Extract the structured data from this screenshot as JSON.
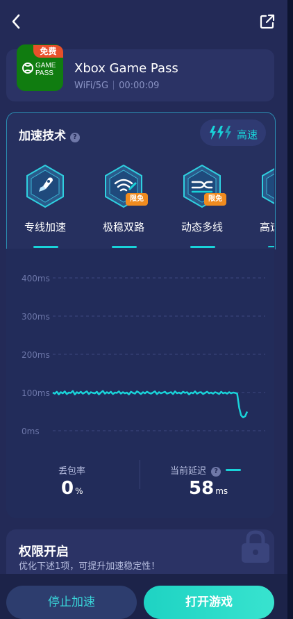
{
  "colors": {
    "background": "#232a57",
    "accent": "#19d3d9",
    "badge": "#f08b1f",
    "free_tag": "#e8502a",
    "xbox_green": "#107c10"
  },
  "header": {
    "back_icon": "chevron-left-icon",
    "share_icon": "external-link-icon"
  },
  "game": {
    "free_tag": "免费",
    "logo_line1": "GAME",
    "logo_line2": "PASS",
    "title": "Xbox Game Pass",
    "network": "WiFi/5G",
    "duration": "00:00:09"
  },
  "accel": {
    "title": "加速技术",
    "speed_label": "高速",
    "items": [
      {
        "label": "专线加速",
        "icon": "rocket-icon",
        "badge": ""
      },
      {
        "label": "极稳双路",
        "icon": "wifi-signal-icon",
        "badge": "限免"
      },
      {
        "label": "动态多线",
        "icon": "multi-line-icon",
        "badge": "限免"
      },
      {
        "label": "高速",
        "icon": "speed-icon",
        "badge": ""
      }
    ]
  },
  "chart_data": {
    "type": "line",
    "title": "",
    "xlabel": "",
    "ylabel": "",
    "ylim": [
      0,
      400
    ],
    "yticks": [
      "400ms",
      "300ms",
      "200ms",
      "100ms",
      "0ms"
    ],
    "grid": true,
    "series": [
      {
        "values": [
          100,
          97,
          102,
          95,
          101,
          98,
          103,
          96,
          100,
          99,
          104,
          95,
          101,
          98,
          102,
          97,
          100,
          103,
          96,
          101,
          99,
          98,
          102,
          95,
          100,
          104,
          97,
          101,
          98,
          102,
          96,
          100,
          99,
          103,
          97,
          101,
          98,
          100,
          95,
          102,
          99,
          97,
          103,
          100,
          96,
          101,
          98,
          102,
          99,
          97,
          100,
          103,
          96,
          101,
          98,
          100,
          102,
          97,
          99,
          101,
          96,
          103,
          98,
          100,
          97,
          102,
          99,
          101,
          95,
          100,
          98,
          103,
          97,
          100,
          101,
          96,
          99,
          102,
          98,
          100,
          97,
          101,
          99,
          96,
          102,
          98,
          100,
          97,
          101,
          98,
          100,
          99,
          97,
          60,
          40,
          35,
          38,
          50
        ]
      }
    ]
  },
  "stats": {
    "loss_label": "丢包率",
    "loss_value": "0",
    "loss_unit": "%",
    "latency_label": "当前延迟",
    "latency_value": "58",
    "latency_unit": "ms"
  },
  "permission": {
    "title": "权限开启",
    "subtitle": "优化下述1项，可提升加速稳定性！"
  },
  "buttons": {
    "stop": "停止加速",
    "open": "打开游戏"
  }
}
